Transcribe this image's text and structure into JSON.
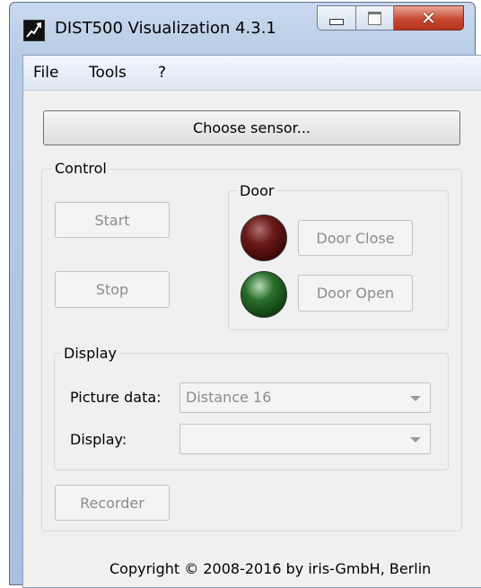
{
  "window": {
    "title": "DIST500 Visualization 4.3.1"
  },
  "menu": {
    "items": [
      "File",
      "Tools",
      "?"
    ]
  },
  "choose_sensor_label": "Choose sensor...",
  "control": {
    "label": "Control",
    "start_label": "Start",
    "stop_label": "Stop",
    "door": {
      "label": "Door",
      "close_label": "Door Close",
      "open_label": "Door Open",
      "close_led_color": "#4a0a0a",
      "open_led_color": "#0f4a0f"
    },
    "display": {
      "label": "Display",
      "picture_data_label": "Picture data:",
      "picture_data_value": "Distance 16",
      "display_label": "Display:",
      "display_value": ""
    },
    "recorder_label": "Recorder"
  },
  "copyright": "Copyright © 2008-2016 by iris-GmbH, Berlin"
}
